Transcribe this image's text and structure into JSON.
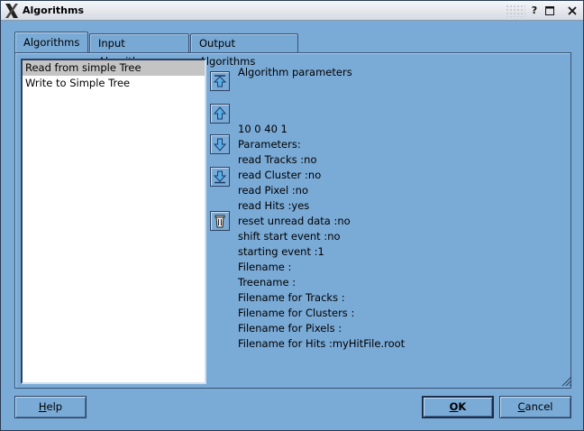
{
  "window": {
    "title": "Algorithms",
    "help_button": "?"
  },
  "tabs": [
    {
      "label": "Algorithms"
    },
    {
      "label": "Input Algorithms"
    },
    {
      "label": "Output Algorithms"
    }
  ],
  "algorithm_list": [
    {
      "label": "Read from simple Tree",
      "selected": true
    },
    {
      "label": "Write to Simple Tree",
      "selected": false
    }
  ],
  "side_icons": [
    "move-top-icon",
    "move-up-icon",
    "move-down-icon",
    "move-bottom-icon",
    "trash-icon"
  ],
  "parameters": {
    "title": "Algorithm parameters",
    "lines": [
      "10 0 40 1",
      "Parameters:",
      "read Tracks :no",
      "read Cluster :no",
      "read Pixel :no",
      "read Hits :yes",
      "reset unread data :no",
      "shift start event :no",
      "starting event :1",
      "Filename :",
      "Treename :",
      "Filename for Tracks :",
      "Filename for Clusters :",
      "Filename for Pixels :",
      "Filename for Hits :myHitFile.root"
    ]
  },
  "buttons": {
    "help": {
      "label_first": "H",
      "label_rest": "elp"
    },
    "ok": {
      "label_first": "O",
      "label_rest": "K"
    },
    "cancel": {
      "label_first": "C",
      "label_rest": "ancel"
    }
  },
  "colors": {
    "background": "#7aaad6",
    "selection": "#c4c4c4",
    "icon_arrow": "#2a7ac8"
  }
}
